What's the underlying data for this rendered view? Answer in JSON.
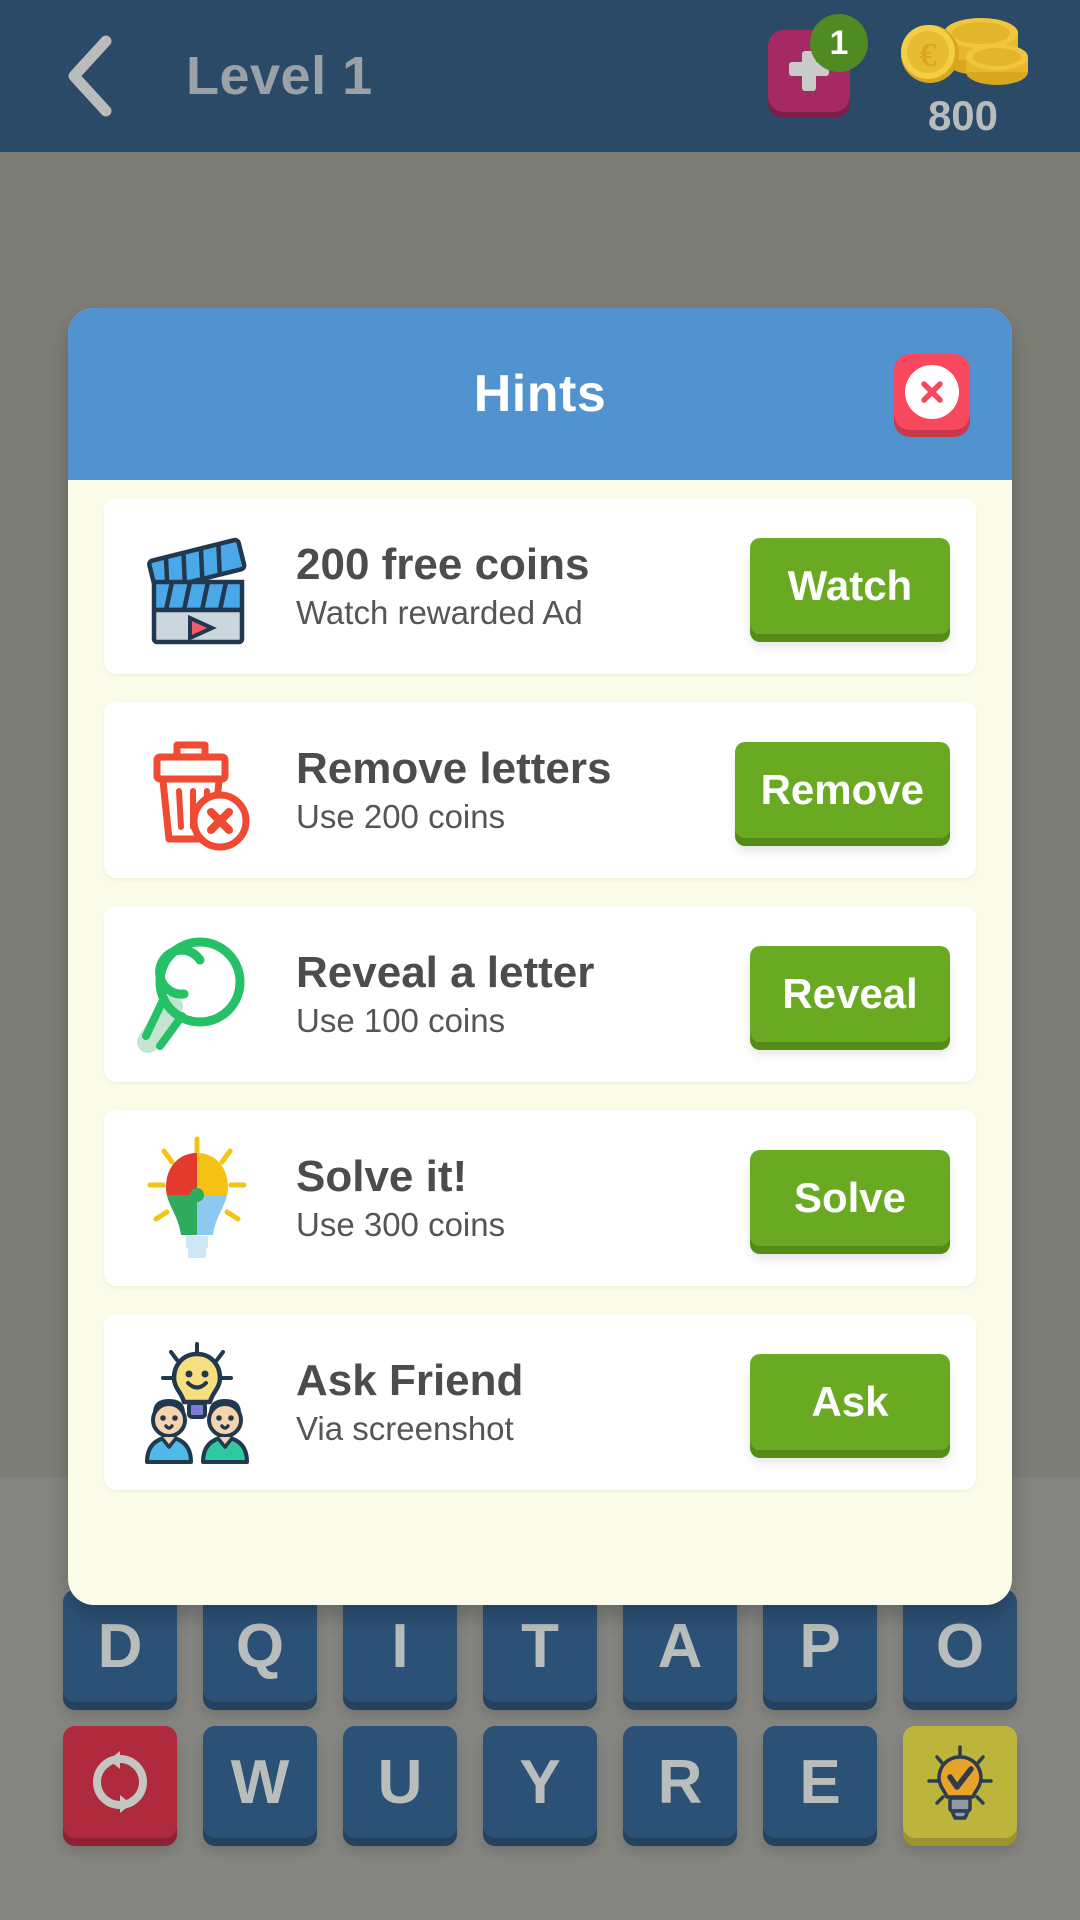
{
  "topbar": {
    "back_icon": "chevron-left-icon",
    "title": "Level 1",
    "add_button_icon": "plus-icon",
    "add_badge_count": "1",
    "coin_icon": "euro-coin-stack-icon",
    "coin_count": "800",
    "bar_color": "#2a4a68"
  },
  "dialog": {
    "title": "Hints",
    "close_icon": "close-x-icon",
    "header_color": "#5093ce",
    "body_color": "#fbfbe9",
    "hints": [
      {
        "icon": "movie-clapperboard-icon",
        "title": "200 free coins",
        "subtitle": "Watch rewarded Ad",
        "button_label": "Watch"
      },
      {
        "icon": "trash-can-remove-icon",
        "title": "Remove letters",
        "subtitle": "Use 200 coins",
        "button_label": "Remove"
      },
      {
        "icon": "magnifying-glass-icon",
        "title": "Reveal a letter",
        "subtitle": "Use 100 coins",
        "button_label": "Reveal"
      },
      {
        "icon": "puzzle-lightbulb-icon",
        "title": "Solve it!",
        "subtitle": "Use 300 coins",
        "button_label": "Solve"
      },
      {
        "icon": "friends-lightbulb-icon",
        "title": "Ask Friend",
        "subtitle": "Via screenshot",
        "button_label": "Ask"
      }
    ],
    "button_color": "#6aaa22",
    "close_color": "#f8485e"
  },
  "keyboard": {
    "row1": [
      {
        "type": "letter",
        "label": "D"
      },
      {
        "type": "letter",
        "label": "Q"
      },
      {
        "type": "letter",
        "label": "I"
      },
      {
        "type": "letter",
        "label": "T"
      },
      {
        "type": "letter",
        "label": "A"
      },
      {
        "type": "letter",
        "label": "P"
      },
      {
        "type": "letter",
        "label": "O"
      }
    ],
    "row2": [
      {
        "type": "shuffle",
        "label": "",
        "icon": "shuffle-refresh-icon"
      },
      {
        "type": "letter",
        "label": "W"
      },
      {
        "type": "letter",
        "label": "U"
      },
      {
        "type": "letter",
        "label": "Y"
      },
      {
        "type": "letter",
        "label": "R"
      },
      {
        "type": "letter",
        "label": "E"
      },
      {
        "type": "hint",
        "label": "",
        "icon": "lightbulb-hint-icon"
      }
    ],
    "key_color": "#2c5176",
    "shuffle_color": "#b02a3d",
    "hint_key_color": "#bdb53b"
  }
}
